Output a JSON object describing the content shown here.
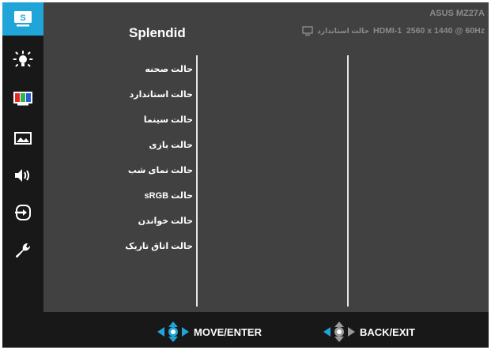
{
  "header": {
    "title": "Splendid",
    "model": "ASUS MZ27A",
    "current_mode": "حالت استاندارد",
    "input_resolution": "HDMI-1  2560 x 1440 @ 60Hz"
  },
  "sidebar": {
    "items": [
      {
        "icon": "splendid-icon",
        "label": "S",
        "active": true
      },
      {
        "icon": "brightness-icon"
      },
      {
        "icon": "color-icon"
      },
      {
        "icon": "image-icon"
      },
      {
        "icon": "sound-icon"
      },
      {
        "icon": "input-select-icon"
      },
      {
        "icon": "system-setup-icon"
      }
    ]
  },
  "menu": {
    "items": [
      {
        "label": "حالت صحنه"
      },
      {
        "label": "حالت استاندارد"
      },
      {
        "label": "حالت سینما"
      },
      {
        "label": "حالت بازی"
      },
      {
        "label": "حالت نمای شب"
      },
      {
        "label": "حالت sRGB"
      },
      {
        "label": "حالت خواندن"
      },
      {
        "label": "حالت اتاق تاریک"
      }
    ]
  },
  "footer": {
    "move_label": "MOVE/ENTER",
    "back_label": "BACK/EXIT"
  },
  "colors": {
    "accent": "#1fa5d8",
    "panel": "#414141",
    "background": "#181818",
    "nav_arrow": "#1fa5d8",
    "nav_arrow_back": "#9a9a9a"
  }
}
